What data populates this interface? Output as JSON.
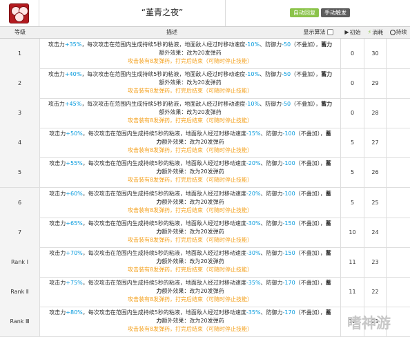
{
  "header": {
    "skill_name": "“堇青之夜”",
    "tag_recovery": "自动回复",
    "tag_trigger": "手动触发"
  },
  "columns": {
    "level": "等级",
    "desc": "描述",
    "toggle": "显示算法",
    "init": "初始",
    "cost": "消耗",
    "duration": "持续"
  },
  "rows": [
    {
      "level": "1",
      "atk": "+35%",
      "slow": "-10%",
      "def": "-50",
      "init": "0",
      "cost": "30"
    },
    {
      "level": "2",
      "atk": "+40%",
      "slow": "-10%",
      "def": "-50",
      "init": "0",
      "cost": "29"
    },
    {
      "level": "3",
      "atk": "+45%",
      "slow": "-10%",
      "def": "-50",
      "init": "0",
      "cost": "28"
    },
    {
      "level": "4",
      "atk": "+50%",
      "slow": "-15%",
      "def": "-100",
      "init": "5",
      "cost": "27"
    },
    {
      "level": "5",
      "atk": "+55%",
      "slow": "-20%",
      "def": "-100",
      "init": "5",
      "cost": "26"
    },
    {
      "level": "6",
      "atk": "+60%",
      "slow": "-20%",
      "def": "-100",
      "init": "5",
      "cost": "25"
    },
    {
      "level": "7",
      "atk": "+65%",
      "slow": "-30%",
      "def": "-150",
      "init": "10",
      "cost": "24"
    },
    {
      "level": "Rank Ⅰ",
      "atk": "+70%",
      "slow": "-30%",
      "def": "-150",
      "init": "11",
      "cost": "23"
    },
    {
      "level": "Rank Ⅱ",
      "atk": "+75%",
      "slow": "-35%",
      "def": "-170",
      "init": "11",
      "cost": "22"
    },
    {
      "level": "Rank Ⅲ",
      "atk": "+80%",
      "slow": "-35%",
      "def": "-170",
      "init": "12",
      "cost": "21"
    }
  ],
  "desc_text": {
    "p1": "攻击力",
    "p2": "，每次攻击在范围内生成持续5秒的粘液，地面敌人经过时移动速度",
    "p3": "、防御力",
    "p4": "（不叠加），",
    "p5": "蓄力",
    "p6": "额外效果：改为20发弹药",
    "line3": "攻击装有8发弹药，打完后结束（可随时停止技能）"
  },
  "watermark": "嗜神游"
}
